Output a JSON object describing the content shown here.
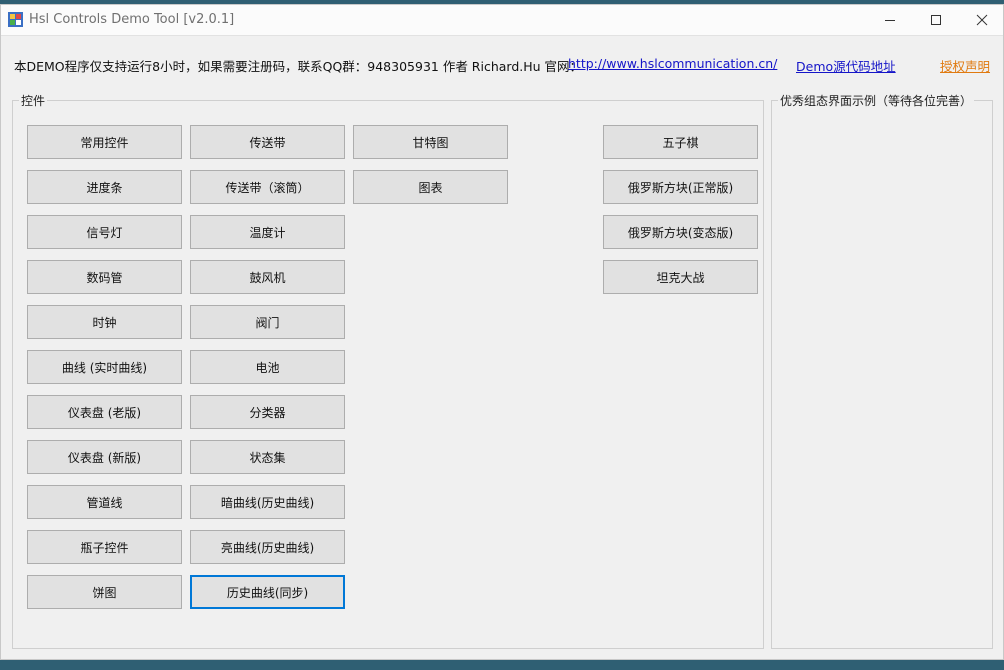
{
  "window": {
    "title": "Hsl Controls Demo Tool [v2.0.1]"
  },
  "info": {
    "notice": "本DEMO程序仅支持运行8小时，如果需要注册码，联系QQ群：948305931  作者 Richard.Hu   官网：",
    "website_link": "http://www.hslcommunication.cn/",
    "source_link": "Demo源代码地址",
    "license_link": "授权声明"
  },
  "controls_group": {
    "title": "控件",
    "column1": [
      "常用控件",
      "进度条",
      "信号灯",
      "数码管",
      "时钟",
      "曲线 (实时曲线)",
      "仪表盘 (老版)",
      "仪表盘 (新版)",
      "管道线",
      "瓶子控件",
      "饼图"
    ],
    "column2": [
      "传送带",
      "传送带（滚筒）",
      "温度计",
      "鼓风机",
      "阀门",
      "电池",
      "分类器",
      "状态集",
      "暗曲线(历史曲线)",
      "亮曲线(历史曲线)",
      "历史曲线(同步)"
    ],
    "column3": [
      "甘特图",
      "图表"
    ],
    "column4": [
      "五子棋",
      "俄罗斯方块(正常版)",
      "俄罗斯方块(变态版)",
      "坦克大战"
    ]
  },
  "examples_group": {
    "title": "优秀组态界面示例（等待各位完善）"
  },
  "icons": {
    "app": "app-icon",
    "minimize": "minimize-icon",
    "maximize": "maximize-icon",
    "close": "close-icon"
  },
  "colors": {
    "focus_border": "#0078d7",
    "link_blue": "#1515c8",
    "link_orange": "#e07a10"
  }
}
